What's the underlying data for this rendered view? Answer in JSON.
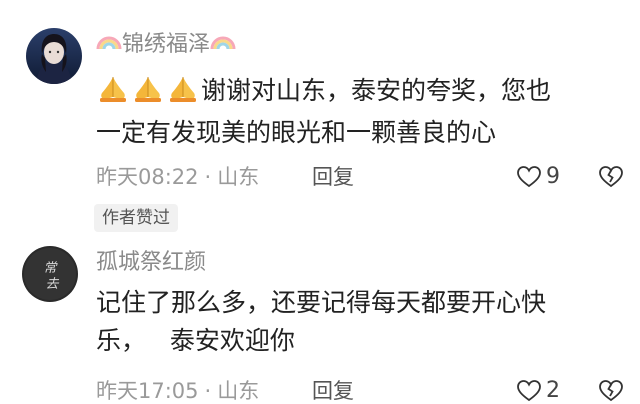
{
  "comments": [
    {
      "username": "锦绣福泽",
      "text_line1": "谢谢对山东，泰安的夸奖，您也",
      "text_line2": "一定有发现美的眼光和一颗善良的心",
      "time": "昨天08:22",
      "location": "山东",
      "reply_label": "回复",
      "likes": "9",
      "author_badge": "作者赞过",
      "icons": [
        "rainbow-icon",
        "praying-hands-icon",
        "heart-icon",
        "broken-heart-icon"
      ]
    },
    {
      "username": "孤城祭红颜",
      "text_line1": "记住了那么多，还要记得每天都要开心快",
      "text_line2": "乐，   泰安欢迎你",
      "time": "昨天17:05",
      "location": "山东",
      "reply_label": "回复",
      "likes": "2",
      "icons": [
        "heart-icon",
        "broken-heart-icon"
      ]
    }
  ],
  "colors": {
    "username": "#8a8a8a",
    "text": "#222222",
    "meta": "#9a9a9a",
    "badge_bg": "#f1f1f1"
  }
}
